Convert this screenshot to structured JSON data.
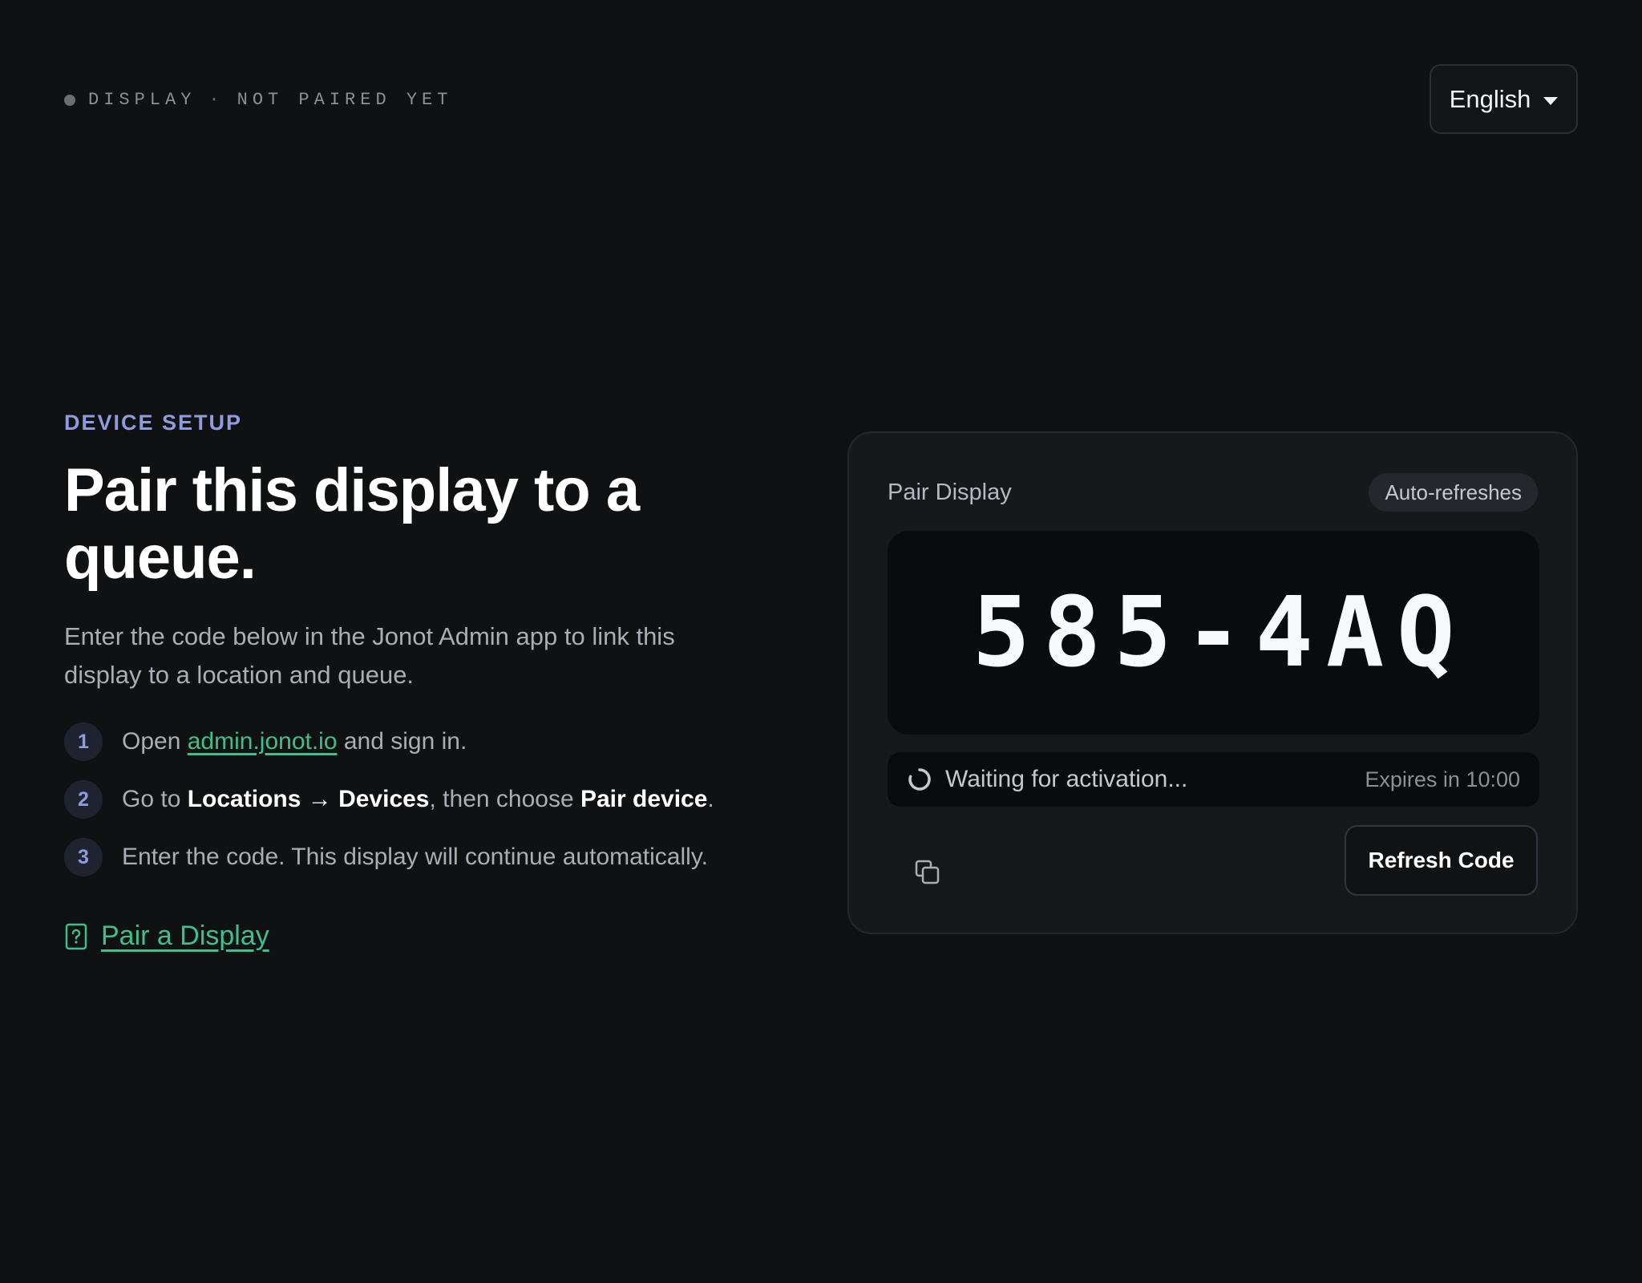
{
  "status": {
    "device_label": "DISPLAY",
    "separator": "·",
    "pairing_state": "NOT PAIRED YET"
  },
  "language": {
    "selected": "English"
  },
  "intro": {
    "eyebrow": "DEVICE SETUP",
    "title": "Pair this display to a queue.",
    "lead": "Enter the code below in the Jonot Admin app to link this display to a location and queue."
  },
  "steps": [
    {
      "number": "1",
      "pre": "Open ",
      "link": "admin.jonot.io",
      "post": " and sign in."
    },
    {
      "number": "2",
      "pre": "Go to ",
      "bold1": "Locations → Devices",
      "mid": ", then choose ",
      "bold2": "Pair device",
      "post": "."
    },
    {
      "number": "3",
      "text": "Enter the code. This display will continue automatically."
    }
  ],
  "help": {
    "label": "Pair a Display",
    "icon": "help-document-icon"
  },
  "card": {
    "title": "Pair Display",
    "badge": "Auto-refreshes",
    "code": "585-4AQ",
    "waiting_text": "Waiting for activation...",
    "expires_text": "Expires in 10:00",
    "refresh_label": "Refresh Code",
    "copy_icon": "copy-icon",
    "spinner_icon": "spinner-icon"
  },
  "colors": {
    "background": "#101113",
    "accent_blue": "#8f9bdc",
    "accent_green": "#3fc08a",
    "card": "#17181b"
  }
}
